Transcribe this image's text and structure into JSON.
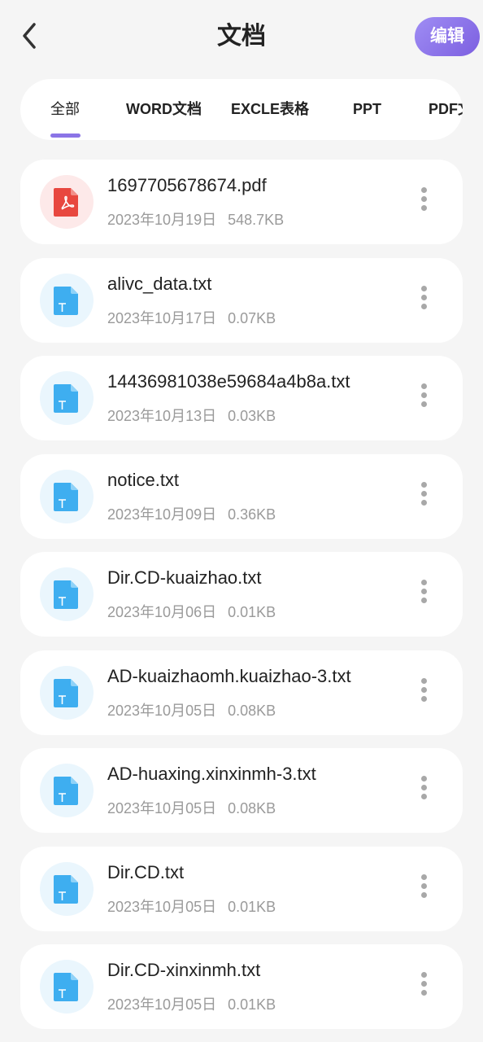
{
  "header": {
    "title": "文档",
    "edit_label": "编辑"
  },
  "tabs": [
    {
      "label": "全部",
      "active": true
    },
    {
      "label": "WORD文档"
    },
    {
      "label": "EXCLE表格"
    },
    {
      "label": "PPT"
    },
    {
      "label": "PDF文"
    }
  ],
  "files": [
    {
      "name": "1697705678674.pdf",
      "date": "2023年10月19日",
      "size": "548.7KB",
      "type": "pdf"
    },
    {
      "name": "alivc_data.txt",
      "date": "2023年10月17日",
      "size": "0.07KB",
      "type": "txt"
    },
    {
      "name": "14436981038e59684a4b8a.txt",
      "date": "2023年10月13日",
      "size": "0.03KB",
      "type": "txt"
    },
    {
      "name": "notice.txt",
      "date": "2023年10月09日",
      "size": "0.36KB",
      "type": "txt"
    },
    {
      "name": "Dir.CD-kuaizhao.txt",
      "date": "2023年10月06日",
      "size": "0.01KB",
      "type": "txt"
    },
    {
      "name": "AD-kuaizhaomh.kuaizhao-3.txt",
      "date": "2023年10月05日",
      "size": "0.08KB",
      "type": "txt"
    },
    {
      "name": "AD-huaxing.xinxinmh-3.txt",
      "date": "2023年10月05日",
      "size": "0.08KB",
      "type": "txt"
    },
    {
      "name": "Dir.CD.txt",
      "date": "2023年10月05日",
      "size": "0.01KB",
      "type": "txt"
    },
    {
      "name": "Dir.CD-xinxinmh.txt",
      "date": "2023年10月05日",
      "size": "0.01KB",
      "type": "txt"
    }
  ],
  "colors": {
    "accent": "#8b74e6",
    "pdf": "#e8473f",
    "txt": "#3eaef0"
  }
}
